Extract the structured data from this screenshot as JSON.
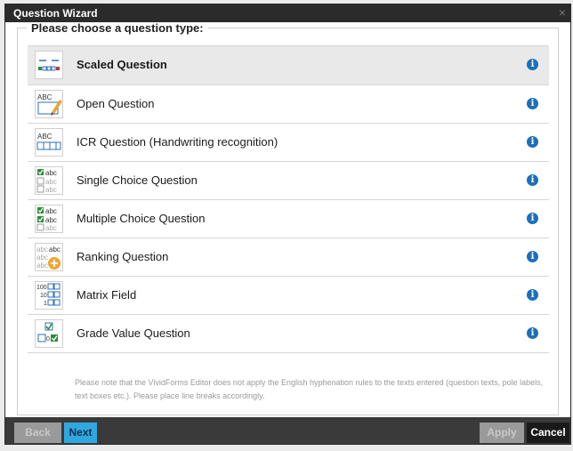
{
  "window": {
    "title": "Question Wizard",
    "close_glyph": "×"
  },
  "group": {
    "legend": "Please choose a question type:"
  },
  "question_types": [
    {
      "label": "Scaled Question",
      "icon": "scaled-question-icon",
      "selected": true
    },
    {
      "label": "Open Question",
      "icon": "open-question-icon",
      "selected": false
    },
    {
      "label": "ICR Question (Handwriting recognition)",
      "icon": "icr-question-icon",
      "selected": false
    },
    {
      "label": "Single Choice Question",
      "icon": "single-choice-icon",
      "selected": false
    },
    {
      "label": "Multiple Choice Question",
      "icon": "multiple-choice-icon",
      "selected": false
    },
    {
      "label": "Ranking Question",
      "icon": "ranking-question-icon",
      "selected": false
    },
    {
      "label": "Matrix Field",
      "icon": "matrix-field-icon",
      "selected": false
    },
    {
      "label": "Grade Value Question",
      "icon": "grade-value-icon",
      "selected": false
    }
  ],
  "info_glyph": "i",
  "note": "Please note that the VividForms Editor does not apply the English hyphenation rules to the texts entered (question texts, pole labels, text boxes etc.). Please place line breaks accordingly.",
  "buttons": {
    "back": "Back",
    "next": "Next",
    "apply": "Apply",
    "cancel": "Cancel"
  },
  "icon_text": {
    "abc": "abc",
    "ABC": "ABC",
    "n100": "100",
    "n10": "10",
    "n1": "1",
    "n0": "0"
  },
  "colors": {
    "titlebar": "#2b2b2b",
    "accent": "#2fa8e0",
    "info": "#1d6fb8",
    "selected_row": "#e9e9e9",
    "check_green": "#2e8b3a"
  }
}
